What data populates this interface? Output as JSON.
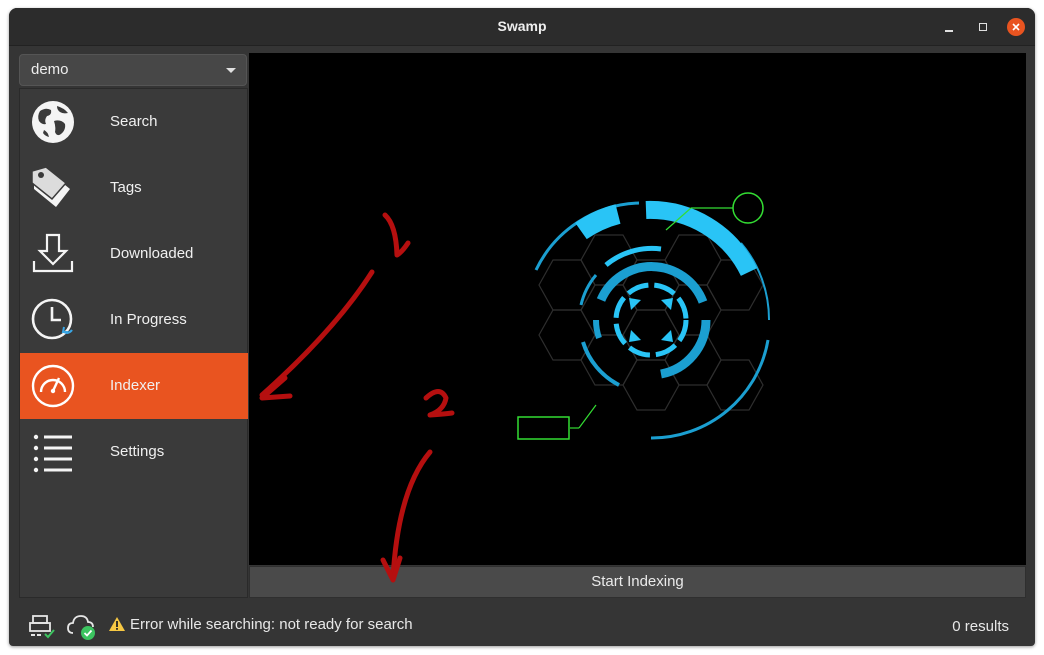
{
  "window": {
    "title": "Swamp"
  },
  "profile": {
    "selected": "demo"
  },
  "sidebar": {
    "items": [
      {
        "label": "Search",
        "icon": "globe-icon"
      },
      {
        "label": "Tags",
        "icon": "tags-icon"
      },
      {
        "label": "Downloaded",
        "icon": "download-icon"
      },
      {
        "label": "In Progress",
        "icon": "clock-icon"
      },
      {
        "label": "Indexer",
        "icon": "gauge-icon",
        "active": true
      },
      {
        "label": "Settings",
        "icon": "list-icon"
      }
    ]
  },
  "main": {
    "start_button_label": "Start Indexing"
  },
  "status": {
    "message": "Error while searching: not ready for search",
    "results": "0 results"
  },
  "annotations": {
    "mark1": "1",
    "mark2": "2"
  },
  "colors": {
    "accent": "#e95420",
    "hud_blue": "#29c4f6",
    "hud_green": "#33dd33"
  }
}
